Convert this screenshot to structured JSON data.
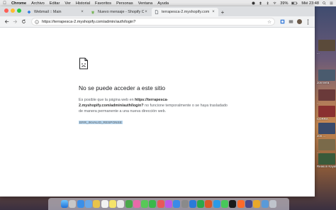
{
  "menubar": {
    "app": "Chrome",
    "items": [
      "Archivo",
      "Editar",
      "Ver",
      "Historial",
      "Favoritos",
      "Personas",
      "Ventana",
      "Ayuda"
    ],
    "battery": "39%",
    "clock": "Mié 23:48"
  },
  "browser": {
    "tabs": [
      {
        "title": "Webmail :: Main",
        "active": false
      },
      {
        "title": "Nuevo mensaje - Shopify Com",
        "active": false
      },
      {
        "title": "terrapesca-2.myshopify.com",
        "active": true
      }
    ],
    "url": "https://terrapesca-2.myshopify.com/admin/auth/login?"
  },
  "error": {
    "heading": "No se puede acceder a este sitio",
    "body_prefix": "Es posible que la página web en",
    "body_url": "https://terrapesca-2.myshopify.com/admin/auth/login?",
    "body_suffix": "no funcione temporalmente o se haya trasladado de manera permanente a una nueva dirección web.",
    "code": "ERR_INVALID_RESPONSE"
  },
  "desktop_icons": [
    {
      "label": "...",
      "icon": "image-thumbnail"
    },
    {
      "label": "Jon terra",
      "icon": "image-thumbnail"
    },
    {
      "label": "...",
      "icon": "image-thumbnail"
    },
    {
      "label": "CORRA",
      "icon": "image-thumbnail"
    },
    {
      "label": "Jon ...",
      "icon": "image-thumbnail"
    },
    {
      "label": "...",
      "icon": "image-thumbnail"
    },
    {
      "label": "Reason Kayaks",
      "icon": "image-thumbnail"
    }
  ],
  "colors": {
    "error_code_highlight": "#b5d4ec",
    "heading": "#202124",
    "body_text": "#5f6368"
  }
}
